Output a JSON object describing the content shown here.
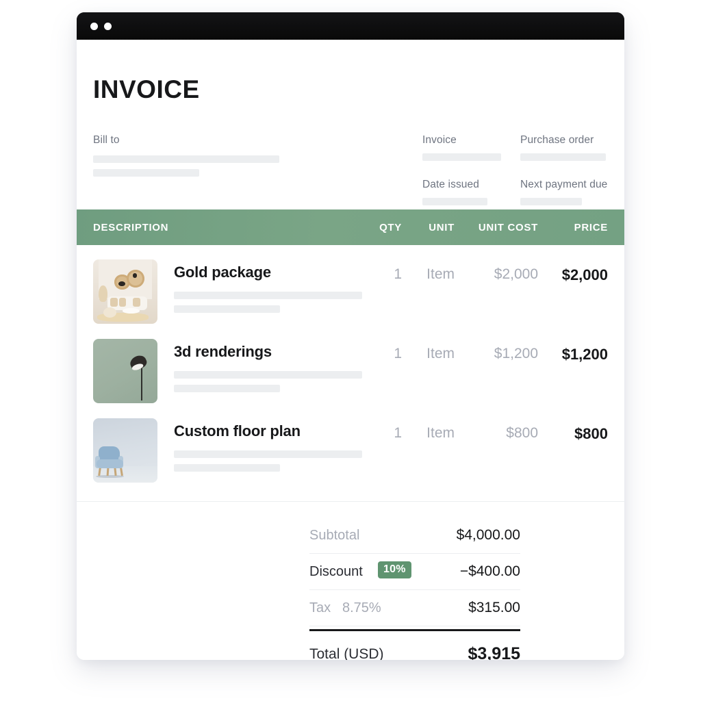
{
  "window": {
    "dots": [
      "window-dot-1",
      "window-dot-2"
    ]
  },
  "header": {
    "title": "INVOICE",
    "bill_to_label": "Bill to",
    "fields": [
      {
        "label": "Invoice"
      },
      {
        "label": "Purchase order"
      },
      {
        "label": "Date issued"
      },
      {
        "label": "Next payment due"
      }
    ]
  },
  "table": {
    "columns": {
      "description": "DESCRIPTION",
      "qty": "QTY",
      "unit": "UNIT",
      "unit_cost": "UNIT COST",
      "price": "PRICE"
    },
    "header_color": "#74a183",
    "rows": [
      {
        "title": "Gold package",
        "qty": "1",
        "unit": "Item",
        "unit_cost": "$2,000",
        "price": "$2,000",
        "thumbnail": "beige-living-room-thumbnail"
      },
      {
        "title": "3d renderings",
        "qty": "1",
        "unit": "Item",
        "unit_cost": "$1,200",
        "price": "$1,200",
        "thumbnail": "sage-floor-lamp-thumbnail"
      },
      {
        "title": "Custom floor plan",
        "qty": "1",
        "unit": "Item",
        "unit_cost": "$800",
        "price": "$800",
        "thumbnail": "blue-armchair-thumbnail"
      }
    ]
  },
  "totals": {
    "subtotal_label": "Subtotal",
    "subtotal_value": "$4,000.00",
    "discount_label": "Discount",
    "discount_badge": "10%",
    "discount_badge_color": "#5f9470",
    "discount_value": "−$400.00",
    "tax_label": "Tax",
    "tax_rate": "8.75%",
    "tax_value": "$315.00",
    "total_label": "Total (USD)",
    "total_value": "$3,915"
  }
}
